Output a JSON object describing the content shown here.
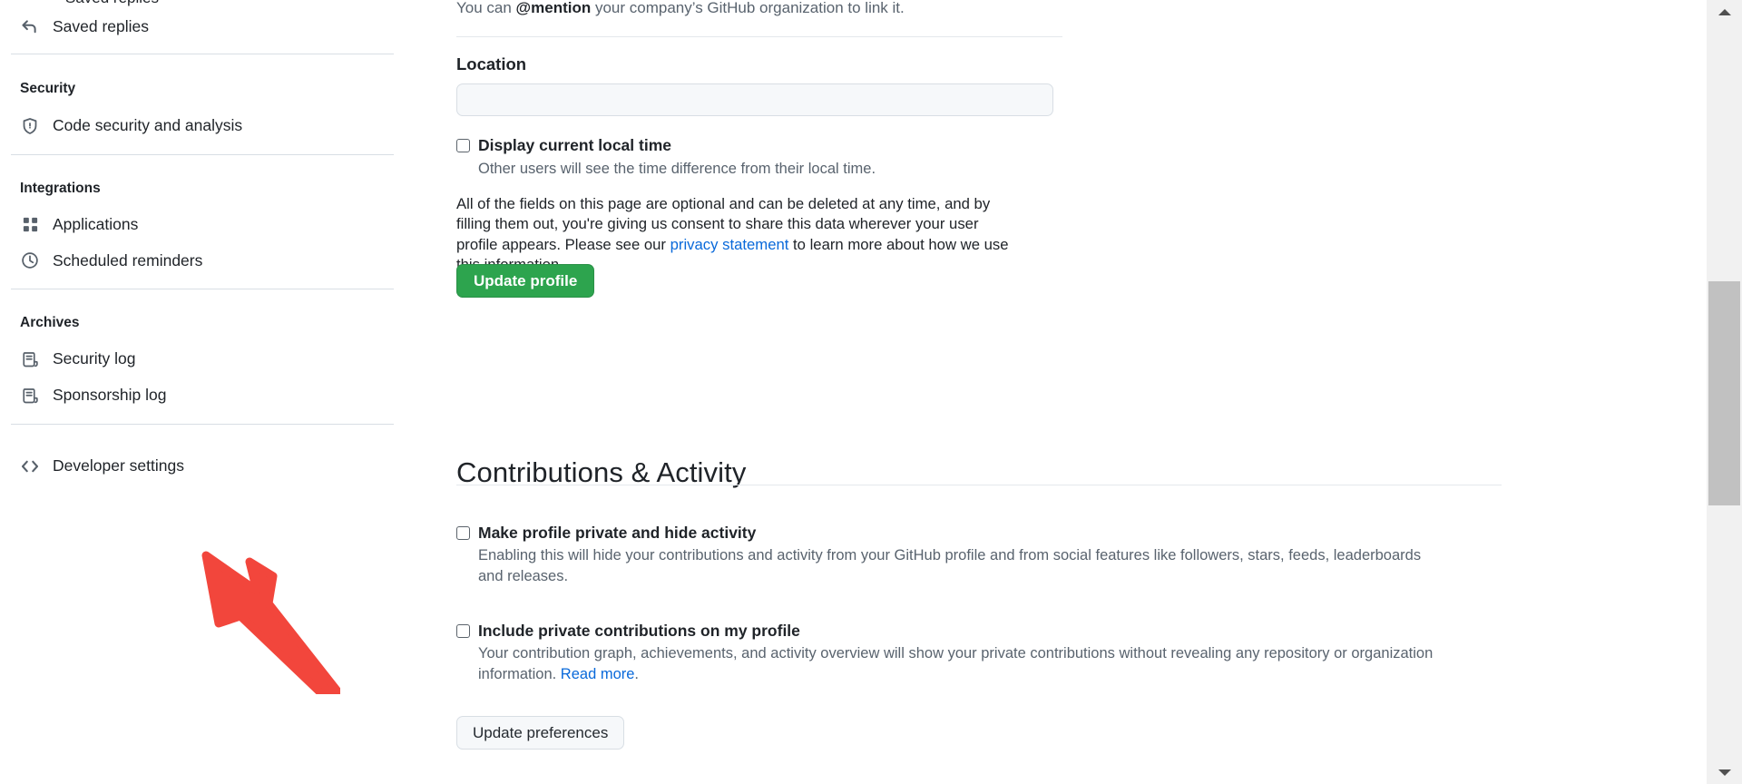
{
  "sidebar": {
    "cut_item_label": "Saved replies",
    "items_top": [
      {
        "label": "Saved replies",
        "icon": "reply-icon"
      }
    ],
    "groups": [
      {
        "title": "Security",
        "items": [
          {
            "label": "Code security and analysis",
            "icon": "shield-lock-icon"
          }
        ]
      },
      {
        "title": "Integrations",
        "items": [
          {
            "label": "Applications",
            "icon": "apps-grid-icon"
          },
          {
            "label": "Scheduled reminders",
            "icon": "clock-icon"
          }
        ]
      },
      {
        "title": "Archives",
        "items": [
          {
            "label": "Security log",
            "icon": "log-icon"
          },
          {
            "label": "Sponsorship log",
            "icon": "log-icon"
          }
        ]
      }
    ],
    "developer": {
      "label": "Developer settings",
      "icon": "code-brackets-icon"
    }
  },
  "main": {
    "mention_prefix": "You can ",
    "mention_bold": "@mention",
    "mention_suffix": " your company’s GitHub organization to link it.",
    "location_label": "Location",
    "location_value": "",
    "location_placeholder": "",
    "display_local_time": {
      "label": "Display current local time",
      "description": "Other users will see the time difference from their local time.",
      "checked": false
    },
    "optional_fields_paragraph_1": "All of the fields on this page are optional and can be deleted at any time, and by filling them out, you're giving us consent to share this data wherever your user profile appears. Please see our ",
    "privacy_statement_link": "privacy statement",
    "optional_fields_paragraph_2": " to learn more about how we use this information.",
    "update_profile_button": "Update profile",
    "contributions_heading": "Contributions & Activity",
    "make_private": {
      "label": "Make profile private and hide activity",
      "description": "Enabling this will hide your contributions and activity from your GitHub profile and from social features like followers, stars, feeds, leaderboards and releases.",
      "checked": false
    },
    "include_private": {
      "label": "Include private contributions on my profile",
      "description_1": "Your contribution graph, achievements, and activity overview will show your private contributions without revealing any repository or organization information. ",
      "read_more_link": "Read more",
      "description_2": ".",
      "checked": false
    },
    "update_preferences_button": "Update preferences"
  },
  "annotation": {
    "type": "arrow",
    "color": "#f2463c",
    "points_to": "Developer settings"
  },
  "scrollbar": {
    "up_arrow": "scroll-up-arrow",
    "down_arrow": "scroll-down-arrow",
    "thumb": "scroll-thumb"
  },
  "colors": {
    "accent_green": "#2da44e",
    "link_blue": "#0969da",
    "annotation_red": "#f2463c",
    "text_primary": "#1f2328",
    "text_muted": "#59636e",
    "border": "#d8dee4"
  }
}
